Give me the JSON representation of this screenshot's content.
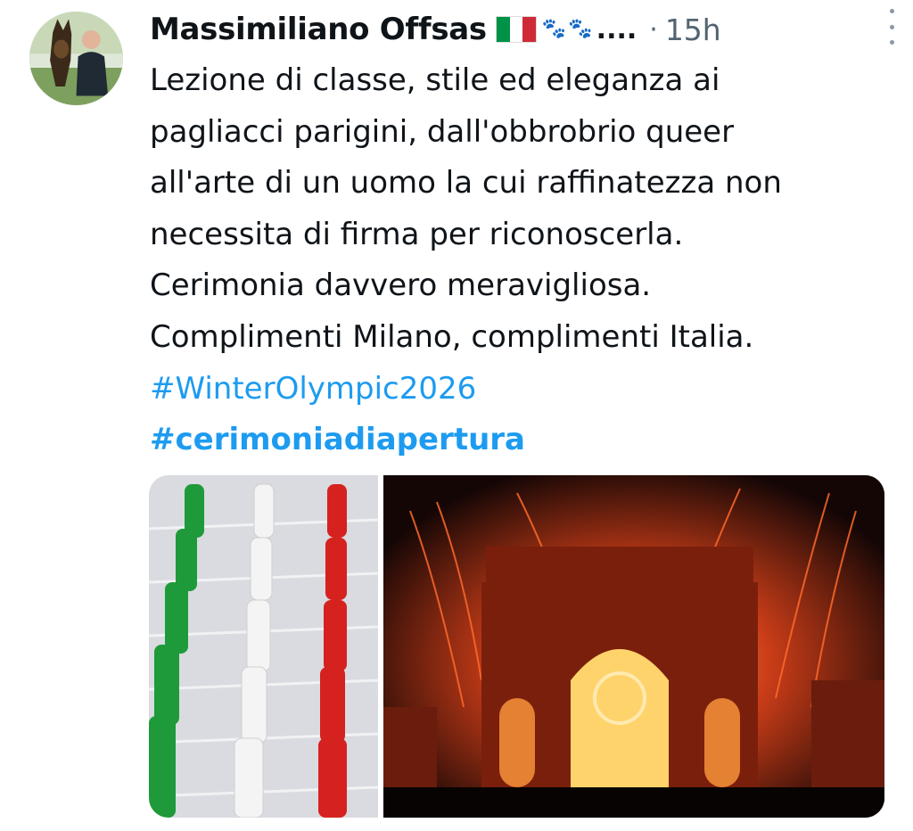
{
  "tweet": {
    "author_name": "Massimiliano Offsas",
    "truncation": "....",
    "separator": "·",
    "time": "15h",
    "text_lines": [
      "Lezione di classe, stile ed eleganza ai",
      "pagliacci parigini, dall'obbrobrio queer",
      "all'arte di un uomo la cui raffinatezza non",
      "necessita di firma per riconoscerla.",
      "Cerimonia davvero meravigliosa.",
      "Complimenti Milano, complimenti Italia."
    ],
    "hashtags": [
      "#WinterOlympic2026",
      "#cerimoniadiapertura"
    ],
    "flag_colors": [
      "#009246",
      "#ffffff",
      "#ce2b37"
    ],
    "accent_color": "#1d9bf0",
    "icons": [
      "avatar",
      "italy-flag-icon",
      "paw-prints-icon",
      "more-options-icon"
    ]
  }
}
